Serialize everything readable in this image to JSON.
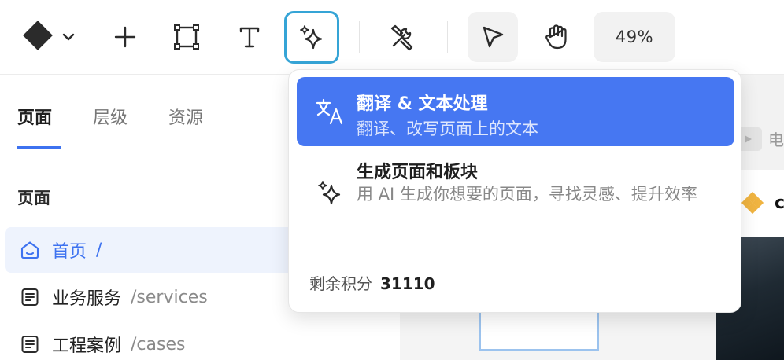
{
  "toolbar": {
    "logo_icon": "brand-diamond-icon",
    "logo_menu_icon": "chevron-down-icon",
    "tools": [
      {
        "name": "add",
        "icon": "plus-icon"
      },
      {
        "name": "frame",
        "icon": "frame-icon"
      },
      {
        "name": "text",
        "icon": "text-icon"
      },
      {
        "name": "ai",
        "icon": "sparkles-icon",
        "active": true
      },
      {
        "name": "tools",
        "icon": "wrench-screwdriver-icon"
      },
      {
        "name": "select",
        "icon": "cursor-icon",
        "selected": true
      },
      {
        "name": "hand",
        "icon": "hand-icon"
      }
    ],
    "zoom": "49%",
    "accent_color": "#35a4d6"
  },
  "left_panel": {
    "tabs": [
      {
        "label": "页面",
        "active": true
      },
      {
        "label": "层级",
        "active": false
      },
      {
        "label": "资源",
        "active": false
      }
    ],
    "section_title": "页面",
    "pages": [
      {
        "label": "首页",
        "path": "/",
        "icon": "home-icon",
        "active": true
      },
      {
        "label": "业务服务",
        "path": "/services",
        "icon": "document-icon",
        "active": false
      },
      {
        "label": "工程案例",
        "path": "/cases",
        "icon": "document-icon",
        "active": false
      }
    ]
  },
  "preview": {
    "bar_text": "电",
    "logo_text": "c"
  },
  "ai_menu": {
    "items": [
      {
        "title": "翻译 & 文本处理",
        "description": "翻译、改写页面上的文本",
        "icon": "translate-icon",
        "selected": true
      },
      {
        "title": "生成页面和板块",
        "description": "用 AI 生成你想要的页面，寻找灵感、提升效率",
        "icon": "sparkles-icon",
        "selected": false
      }
    ],
    "credits_label": "剩余积分",
    "credits_value": "31110",
    "highlight_color": "#4677f2"
  }
}
